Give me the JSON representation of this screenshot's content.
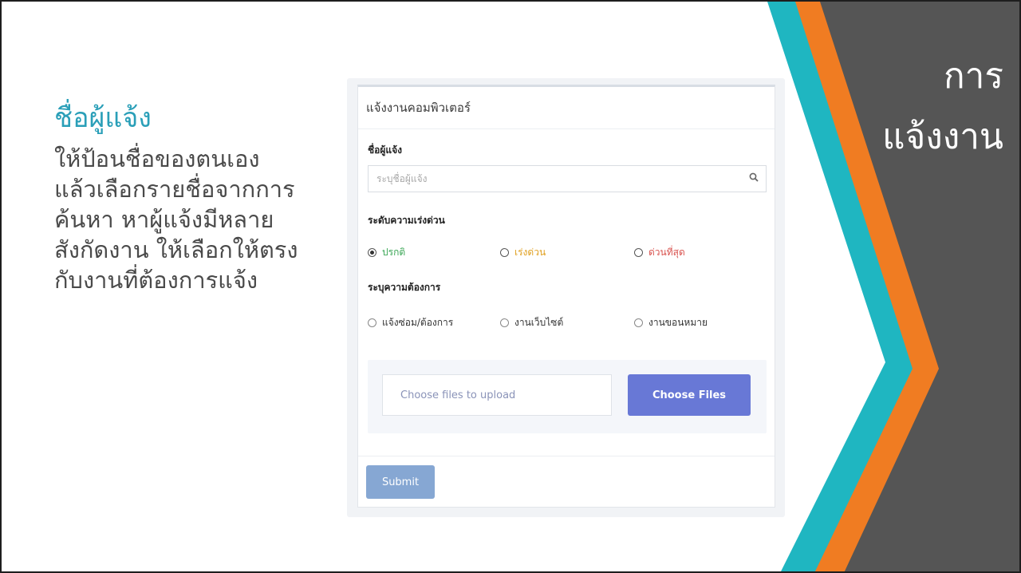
{
  "slide": {
    "side_title_line1": "การ",
    "side_title_line2": "แจ้งงาน",
    "left_heading": "ชื่อผู้แจ้ง",
    "left_body_lines": [
      "ให้ป้อนชื่อของตนเอง",
      "แล้วเลือกรายชื่อจากการ",
      "ค้นหา หาผู้แจ้งมีหลาย",
      "สังกัดงาน ให้เลือกให้ตรง",
      "กับงานที่ต้องการแจ้ง"
    ]
  },
  "form": {
    "panel_title": "แจ้งงานคอมพิวเตอร์",
    "reporter_label": "ชื่อผู้แจ้ง",
    "reporter_placeholder": "ระบุชื่อผู้แจ้ง",
    "search_icon": "search-icon",
    "urgency_label": "ระดับความเร่งด่วน",
    "urgency_options": [
      {
        "label": "ปรกติ",
        "color": "#3aa655",
        "selected": true
      },
      {
        "label": "เร่งด่วน",
        "color": "#e0a020",
        "selected": false
      },
      {
        "label": "ด่วนที่สุด",
        "color": "#d9534f",
        "selected": false
      }
    ],
    "need_label": "ระบุความต้องการ",
    "need_options": [
      {
        "label": "แจ้งซ่อม/ต้องการ"
      },
      {
        "label": "งานเว็บไซต์"
      },
      {
        "label": "งานขอนหมาย"
      }
    ],
    "upload_placeholder": "Choose files to upload",
    "choose_files_label": "Choose Files",
    "submit_label": "Submit"
  },
  "colors": {
    "accent_teal": "#1fb6c1",
    "accent_orange": "#f07c22",
    "side_dark": "#555555",
    "button_purple": "#6878d6",
    "submit_blue": "#86a7d3"
  }
}
